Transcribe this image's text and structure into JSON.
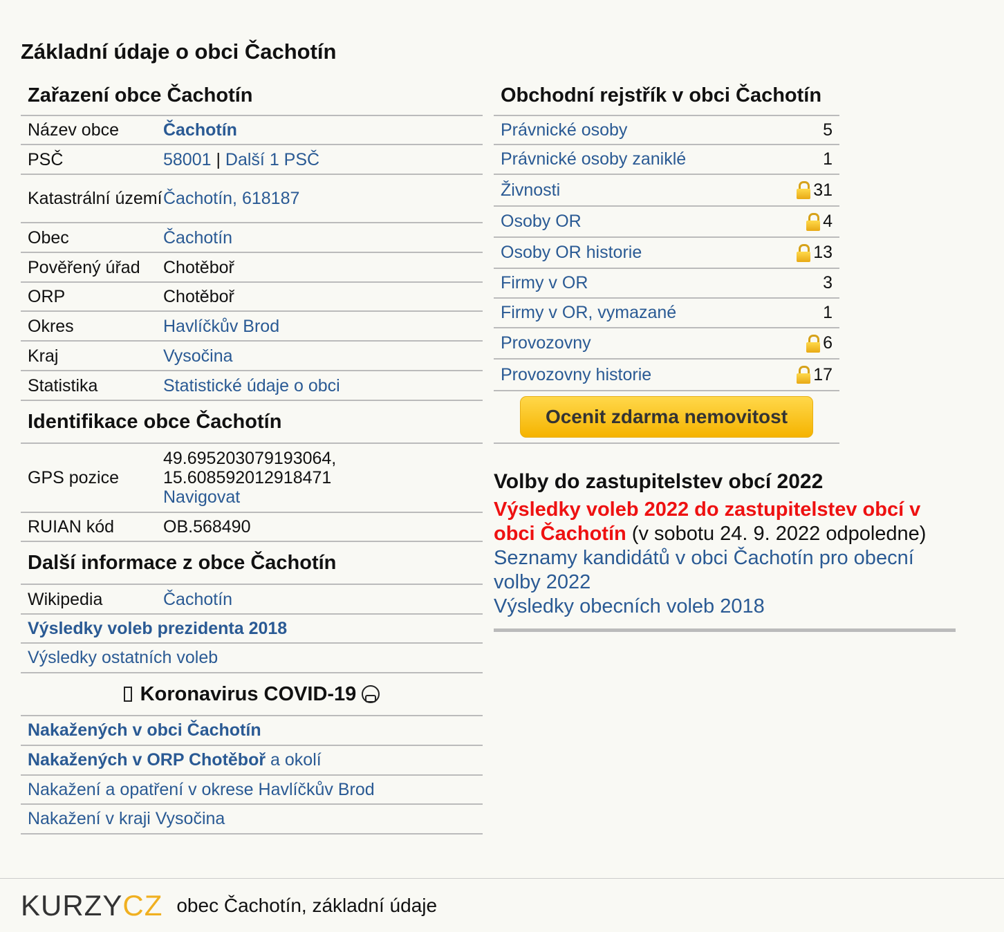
{
  "page_title": "Základní údaje o obci Čachotín",
  "zarazeni": {
    "title": "Zařazení obce Čachotín",
    "rows": [
      {
        "key": "Název obce",
        "value": "Čachotín"
      },
      {
        "key": "PSČ",
        "value_a": "58001",
        "sep": " | ",
        "value_b": "Další 1 PSČ"
      },
      {
        "key": "Katastrální území",
        "value": "Čachotín, 618187"
      },
      {
        "key": "Obec",
        "value": "Čachotín"
      },
      {
        "key": "Pověřený úřad",
        "value": "Chotěboř"
      },
      {
        "key": "ORP",
        "value": "Chotěboř"
      },
      {
        "key": "Okres",
        "value": "Havlíčkův Brod"
      },
      {
        "key": "Kraj",
        "value": "Vysočina"
      },
      {
        "key": "Statistika",
        "value": "Statistické údaje o obci"
      }
    ]
  },
  "identifikace": {
    "title": "Identifikace obce Čachotín",
    "gps_key": "GPS pozice",
    "gps_lat": "49.695203079193064,",
    "gps_lon": "15.608592012918471",
    "gps_link": "Navigovat",
    "ruian_key": "RUIAN kód",
    "ruian_value": "OB.568490"
  },
  "dalsi": {
    "title": "Další informace z obce Čachotín",
    "wiki_key": "Wikipedia",
    "wiki_value": "Čachotín",
    "prezident": "Výsledky voleb prezidenta 2018",
    "ostatni": "Výsledky ostatních voleb"
  },
  "covid": {
    "title": "Koronavirus COVID-19",
    "obec": "Nakažených v obci Čachotín",
    "orp_bold": "Nakažených v ORP Chotěboř",
    "orp_rest": " a okolí",
    "okres": "Nakažení a opatření v okrese Havlíčkův Brod",
    "kraj": "Nakažení v kraji Vysočina"
  },
  "rejstrik": {
    "title": "Obchodní rejstřík v obci Čachotín",
    "rows": [
      {
        "label": "Právnické osoby",
        "count": "5"
      },
      {
        "label": "Právnické osoby zaniklé",
        "count": "1"
      },
      {
        "label": "Živnosti",
        "count": "31",
        "locked": true
      },
      {
        "label": "Osoby OR",
        "count": "4",
        "locked": true
      },
      {
        "label": "Osoby OR historie",
        "count": "13",
        "locked": true
      },
      {
        "label": "Firmy v OR",
        "count": "3"
      },
      {
        "label": "Firmy v OR, vymazané",
        "count": "1"
      },
      {
        "label": "Provozovny",
        "count": "6",
        "locked": true
      },
      {
        "label": "Provozovny historie",
        "count": "17",
        "locked": true
      }
    ],
    "cta": "Ocenit zdarma nemovitost"
  },
  "volby": {
    "title": "Volby do zastupitelstev obcí 2022",
    "results_link": "Výsledky voleb 2022 do zastupitelstev obcí v obci Čachotín",
    "results_note": " (v sobotu 24. 9. 2022 odpoledne)",
    "kandidati": "Seznamy kandidátů v obci Čachotín pro obecní volby 2022",
    "vysledky_2018": "Výsledky obecních voleb 2018"
  },
  "footer": {
    "logo_a": "KURZY",
    "logo_b": "CZ",
    "text": "obec Čachotín, základní údaje"
  },
  "colors": {
    "link": "#2a5a94",
    "red": "#ee1111",
    "accent": "#f5b300",
    "background": "#f9f9f4"
  }
}
